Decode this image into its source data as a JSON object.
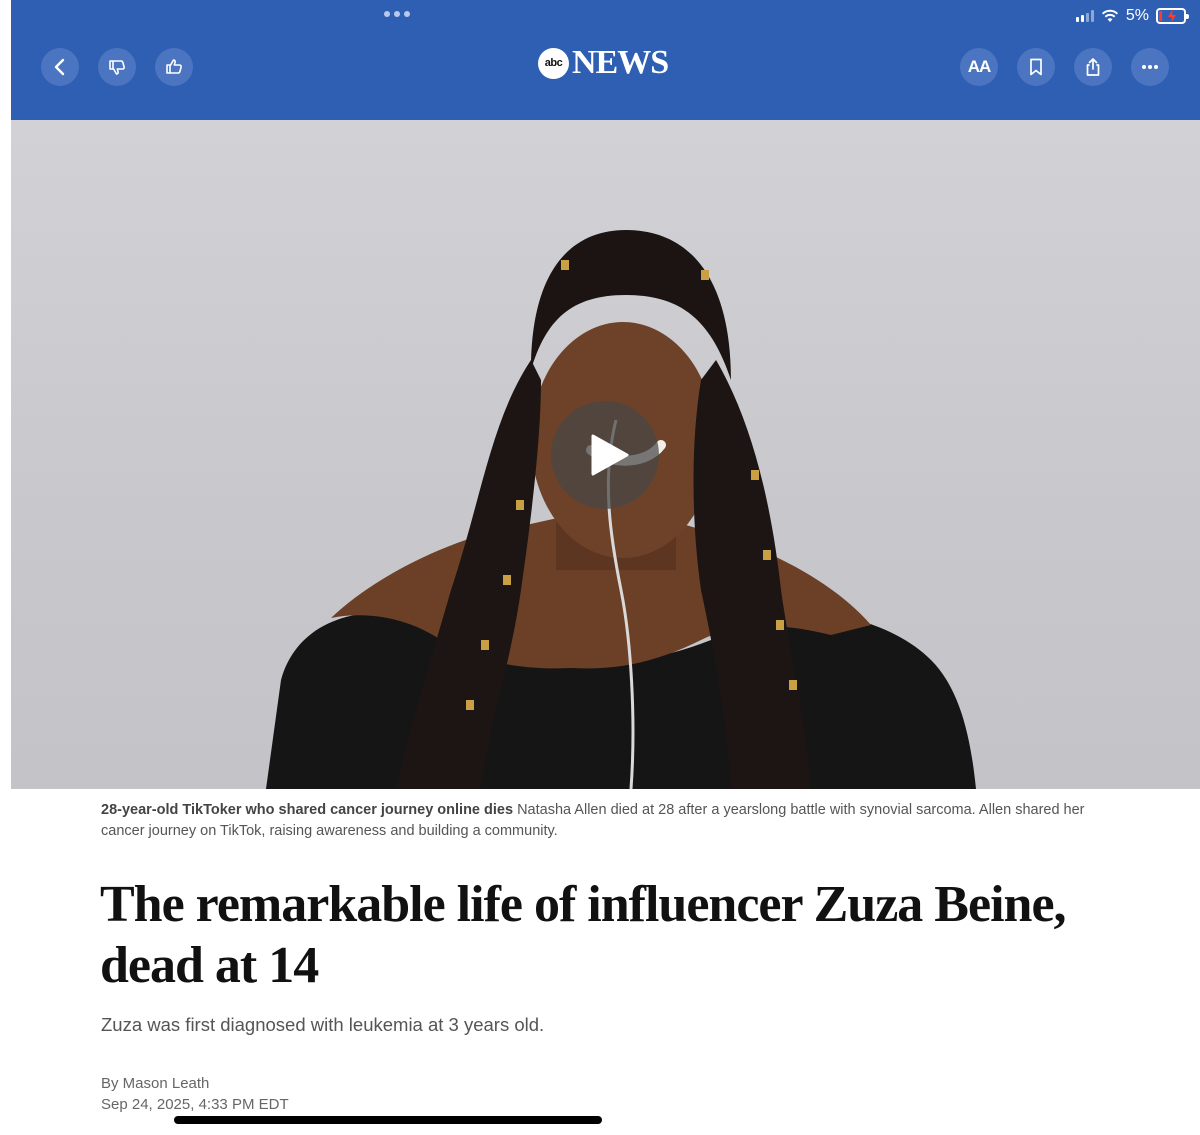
{
  "status_bar": {
    "battery_percent": "5%",
    "battery_level": 0.05,
    "charging": true
  },
  "toolbar": {
    "back_icon": "chevron-left-icon",
    "dislike_icon": "thumbs-down-icon",
    "like_icon": "thumbs-up-icon",
    "text_size_label": "AA",
    "bookmark_icon": "bookmark-icon",
    "share_icon": "share-icon",
    "more_icon": "ellipsis-icon"
  },
  "brand": {
    "logo_badge": "abc",
    "logo_word": "NEWS",
    "header_color": "#2f5fb3"
  },
  "video": {
    "play_icon": "play-icon"
  },
  "caption": {
    "title": "28-year-old TikToker who shared cancer journey online dies",
    "text": " Natasha Allen died at 28 after a yearslong battle with synovial sarcoma. Allen shared her cancer journey on TikTok, raising awareness and building a community."
  },
  "article": {
    "headline": "The remarkable life of influencer Zuza Beine, dead at 14",
    "dek": "Zuza was first diagnosed with leukemia at 3 years old.",
    "byline": "By Mason Leath",
    "date": "Sep 24, 2025, 4:33 PM EDT"
  }
}
